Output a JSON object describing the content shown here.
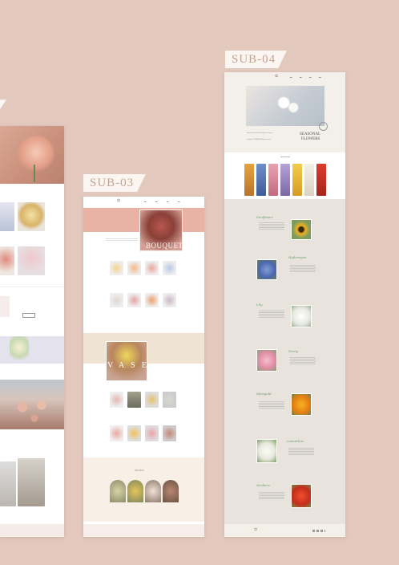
{
  "labels": {
    "sub03": "SUB-03",
    "sub04": "SUB-04"
  },
  "sub03": {
    "hero_word": "BOUQUET",
    "vase_word": "VASE",
    "review_title": "REVIEW"
  },
  "sub04": {
    "hero_title_1": "SEASONAL",
    "hero_title_2": "FLOWERS",
    "hero_line_1": "A flower that resembles the fragrance of summer",
    "hero_line_2": "Copyright © SPRINGBOX All rights reserved.",
    "flowers": [
      {
        "name": "Sunflower"
      },
      {
        "name": "Hydrangea"
      },
      {
        "name": "Lily"
      },
      {
        "name": "Peony"
      },
      {
        "name": "Marigold"
      },
      {
        "name": "Lisianthus"
      },
      {
        "name": "Gerbera"
      }
    ]
  },
  "colors": {
    "background": "#e3c9bd",
    "accent_pink": "#e8b3a4",
    "cream": "#efe3d4",
    "paper": "#e8e4dd"
  }
}
